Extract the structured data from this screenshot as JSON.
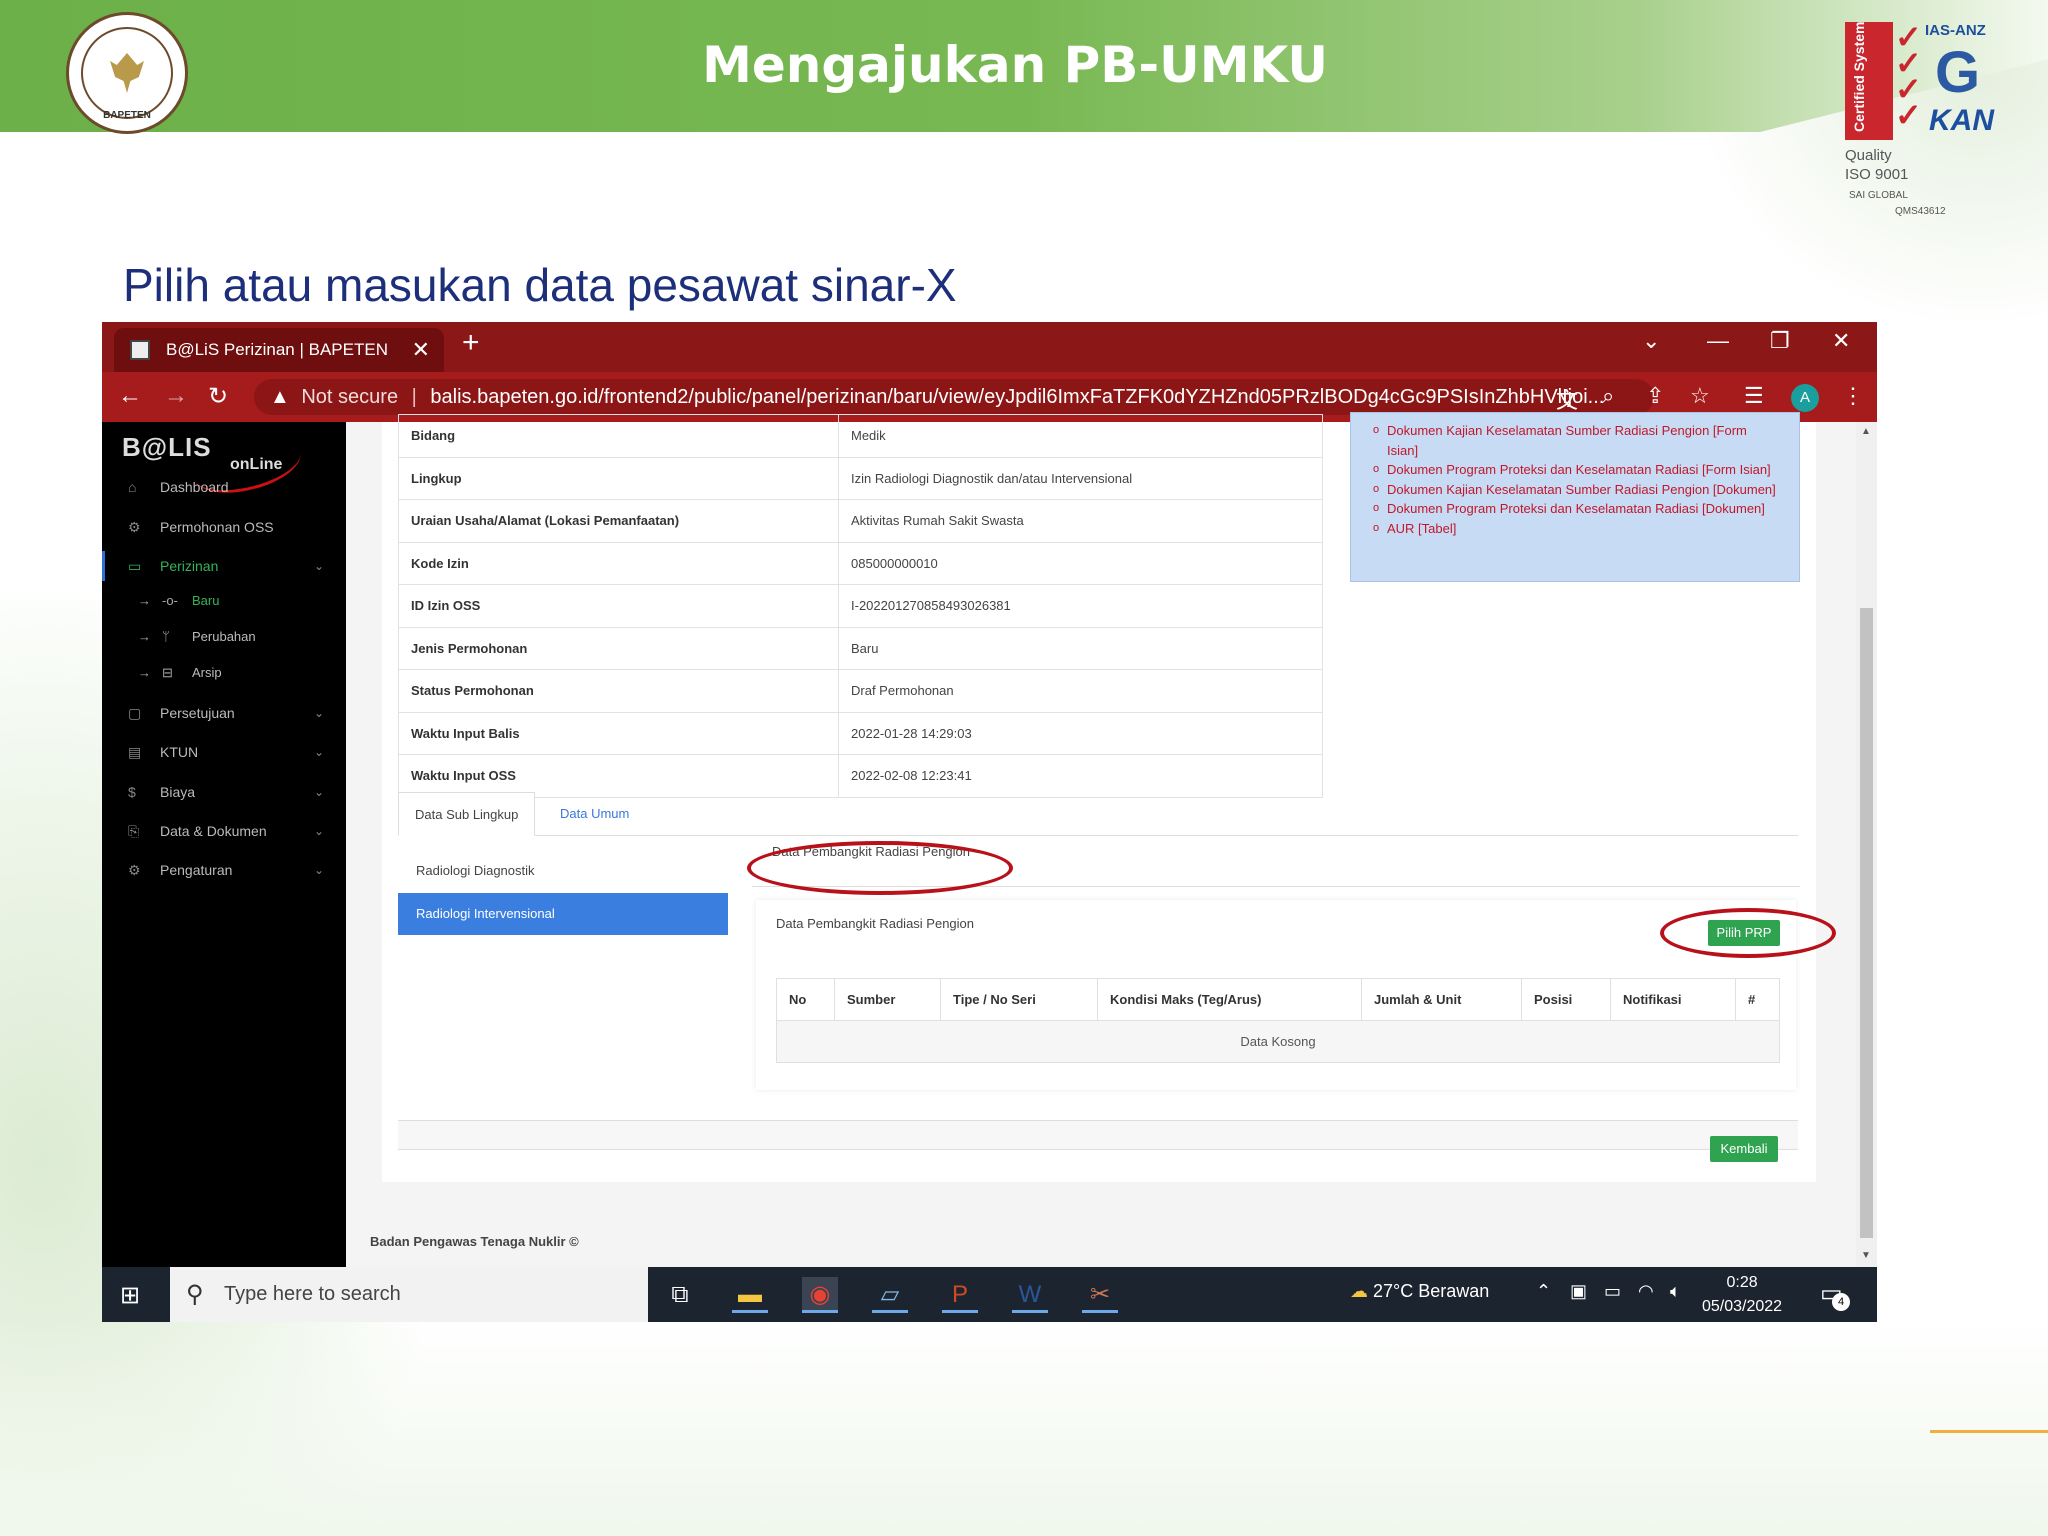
{
  "slide": {
    "title": "Mengajukan PB-UMKU",
    "subtitle": "Pilih atau masukan data pesawat sinar-X",
    "logo_text": "BAPETEN",
    "cert": {
      "side_text": "Certified System",
      "ias": "IAS-ANZ",
      "kan": "KAN",
      "quality": "Quality",
      "iso": "ISO 9001",
      "sai": "SAI GLOBAL",
      "qms": "QMS43612"
    }
  },
  "browser": {
    "tab_title": "B@LiS Perizinan | BAPETEN",
    "not_secure": "Not secure",
    "url": "balis.bapeten.go.id/frontend2/public/panel/perizinan/baru/view/eyJpdil6ImxFaTZFK0dYZHZnd05PRzlBODg4cGc9PSIsInZhbHVlIjoi...",
    "avatar_letter": "A"
  },
  "sidebar": {
    "brand": "B@LIS",
    "brand_sub": "onLine",
    "items": [
      {
        "label": "Dashboard",
        "icon": "home-icon"
      },
      {
        "label": "Permohonan OSS",
        "icon": "gear-icon"
      },
      {
        "label": "Perizinan",
        "icon": "document-icon"
      },
      {
        "label": "Persetujuan",
        "icon": "folder-icon"
      },
      {
        "label": "KTUN",
        "icon": "card-icon"
      },
      {
        "label": "Biaya",
        "icon": "dollar-icon"
      },
      {
        "label": "Data & Dokumen",
        "icon": "clipboard-icon"
      },
      {
        "label": "Pengaturan",
        "icon": "settings-icon"
      }
    ],
    "sub_items": [
      {
        "label": "Baru"
      },
      {
        "label": "Perubahan"
      },
      {
        "label": "Arsip"
      }
    ]
  },
  "info": {
    "rows": [
      {
        "key": "Bidang",
        "value": "Medik"
      },
      {
        "key": "Lingkup",
        "value": "Izin Radiologi Diagnostik dan/atau Intervensional"
      },
      {
        "key": "Uraian Usaha/Alamat (Lokasi Pemanfaatan)",
        "value": "Aktivitas Rumah Sakit Swasta"
      },
      {
        "key": "Kode Izin",
        "value": "085000000010"
      },
      {
        "key": "ID Izin OSS",
        "value": "I-202201270858493026381"
      },
      {
        "key": "Jenis Permohonan",
        "value": "Baru"
      },
      {
        "key": "Status Permohonan",
        "value": "Draf Permohonan"
      },
      {
        "key": "Waktu Input Balis",
        "value": "2022-01-28 14:29:03"
      },
      {
        "key": "Waktu Input OSS",
        "value": "2022-02-08 12:23:41"
      }
    ]
  },
  "documents": [
    "Dokumen Kajian Keselamatan Sumber Radiasi Pengion [Form Isian]",
    "Dokumen Program Proteksi dan Keselamatan Radiasi [Form Isian]",
    "Dokumen Kajian Keselamatan Sumber Radiasi Pengion [Dokumen]",
    "Dokumen Program Proteksi dan Keselamatan Radiasi [Dokumen]",
    "AUR [Tabel]"
  ],
  "tabs": {
    "sub_lingkup": "Data Sub Lingkup",
    "umum": "Data Umum"
  },
  "sub_lingkup": [
    "Radiologi Diagnostik",
    "Radiologi Intervensional"
  ],
  "prp": {
    "tab_label": "Data Pembangkit Radiasi Pengion",
    "panel_title": "Data Pembangkit Radiasi Pengion",
    "button": "Pilih PRP",
    "columns": [
      "No",
      "Sumber",
      "Tipe / No Seri",
      "Kondisi Maks (Teg/Arus)",
      "Jumlah & Unit",
      "Posisi",
      "Notifikasi",
      "#"
    ],
    "empty": "Data Kosong"
  },
  "kembali": "Kembali",
  "footer": "Badan Pengawas Tenaga Nuklir ©",
  "taskbar": {
    "search_placeholder": "Type here to search",
    "weather": "27°C  Berawan",
    "time": "0:28",
    "date": "05/03/2022",
    "notif_count": "4"
  },
  "colors": {
    "banner_green": "#6cb04a",
    "browser_red": "#8c1717",
    "primary_blue": "#3a7fe0",
    "button_green": "#2fa34f",
    "doc_link_red": "#c0182a",
    "annotation_red": "#b8111a"
  }
}
